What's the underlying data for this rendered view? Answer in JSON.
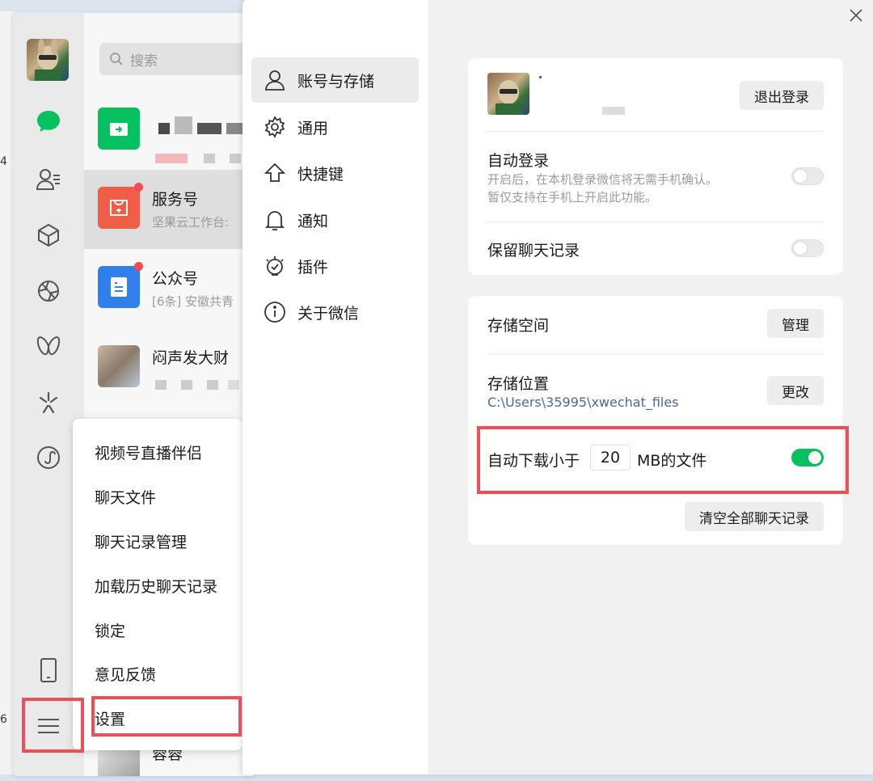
{
  "background": {
    "left_marks": [
      "4",
      "6"
    ]
  },
  "chat_list": {
    "search_placeholder": "搜索",
    "items": [
      {
        "name": "服务号",
        "preview": "坚果云工作台:",
        "unread": true
      },
      {
        "name": "公众号",
        "preview": "[6条] 安徽共青",
        "unread": true
      },
      {
        "name": "闷声发大财",
        "preview": ""
      },
      {
        "name": "蓉蓉",
        "preview": ""
      }
    ]
  },
  "menu": {
    "items": [
      "视频号直播伴侣",
      "聊天文件",
      "聊天记录管理",
      "加载历史聊天记录",
      "锁定",
      "意见反馈",
      "设置"
    ]
  },
  "settings": {
    "nav": [
      {
        "label": "账号与存储",
        "icon": "user-icon",
        "active": true
      },
      {
        "label": "通用",
        "icon": "gear-icon"
      },
      {
        "label": "快捷键",
        "icon": "arrow-up-icon"
      },
      {
        "label": "通知",
        "icon": "bell-icon"
      },
      {
        "label": "插件",
        "icon": "plugin-icon"
      },
      {
        "label": "关于微信",
        "icon": "info-icon"
      }
    ],
    "account": {
      "logout_label": "退出登录",
      "auto_login_label": "自动登录",
      "auto_login_desc_1": "开启后，在本机登录微信将无需手机确认。",
      "auto_login_desc_2": "暂仅支持在手机上开启此功能。",
      "auto_login_on": false,
      "keep_history_label": "保留聊天记录",
      "keep_history_on": false
    },
    "storage": {
      "space_label": "存储空间",
      "manage_label": "管理",
      "location_label": "存储位置",
      "location_path": "C:\\Users\\35995\\xwechat_files",
      "change_label": "更改",
      "auto_download_prefix": "自动下载小于",
      "auto_download_value": "20",
      "auto_download_suffix": "MB的文件",
      "auto_download_on": true,
      "clear_label": "清空全部聊天记录"
    }
  },
  "colors": {
    "accent": "#07c160",
    "highlight": "#f04d5a",
    "link": "#4a6a96"
  }
}
